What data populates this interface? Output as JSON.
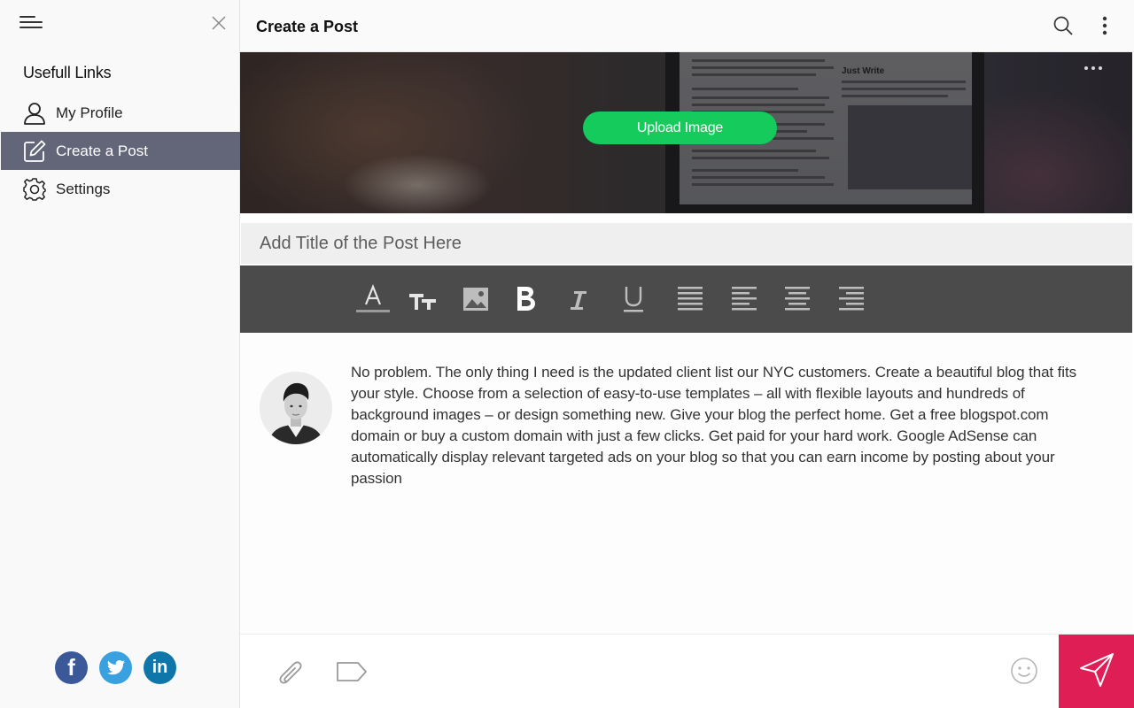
{
  "sidebar": {
    "menu_icon": "menu-icon",
    "close_icon": "close-icon",
    "heading": "Usefull Links",
    "items": [
      {
        "label": "My Profile",
        "icon": "user-icon",
        "active": false
      },
      {
        "label": "Create a Post",
        "icon": "edit-icon",
        "active": true
      },
      {
        "label": "Settings",
        "icon": "gear-icon",
        "active": false
      }
    ],
    "socials": [
      {
        "name": "facebook",
        "icon": "facebook-icon",
        "glyph": "f",
        "color": "#3b5998"
      },
      {
        "name": "twitter",
        "icon": "twitter-icon",
        "color": "#3aa1e0"
      },
      {
        "name": "linkedin",
        "icon": "linkedin-icon",
        "glyph": "in",
        "color": "#0e76a8"
      }
    ]
  },
  "header": {
    "title": "Create a Post",
    "search_icon": "search-icon",
    "more_icon": "more-vertical-icon"
  },
  "cover": {
    "upload_label": "Upload Image",
    "upload_color": "#14cb5b",
    "more_icon": "more-horizontal-icon",
    "screen_heading": "Just Write"
  },
  "post": {
    "title_placeholder": "Add Title of the Post Here",
    "body": "No problem. The only thing I need is the updated client list our NYC customers. Create a beautiful blog that fits your style. Choose from a selection of easy-to-use templates – all with flexible layouts and hundreds of background images – or design something new. Give your blog the perfect home. Get a free blogspot.com domain or buy a custom domain with just a few clicks. Get paid for your hard work. Google AdSense can automatically display relevant targeted ads on your blog so that you can earn income by posting about your passion"
  },
  "toolbar": {
    "tools": [
      "text-color-icon",
      "text-size-icon",
      "image-icon",
      "bold-icon",
      "italic-icon",
      "underline-icon",
      "align-justify-icon",
      "align-left-icon",
      "align-center-icon",
      "align-right-icon"
    ]
  },
  "bottom_bar": {
    "attach_icon": "paperclip-icon",
    "tag_icon": "tag-icon",
    "emoji_icon": "emoji-icon",
    "send_icon": "send-icon",
    "send_color": "#df1e56"
  },
  "colors": {
    "active_nav": "#636679",
    "toolbar": "#4b4b4b"
  }
}
